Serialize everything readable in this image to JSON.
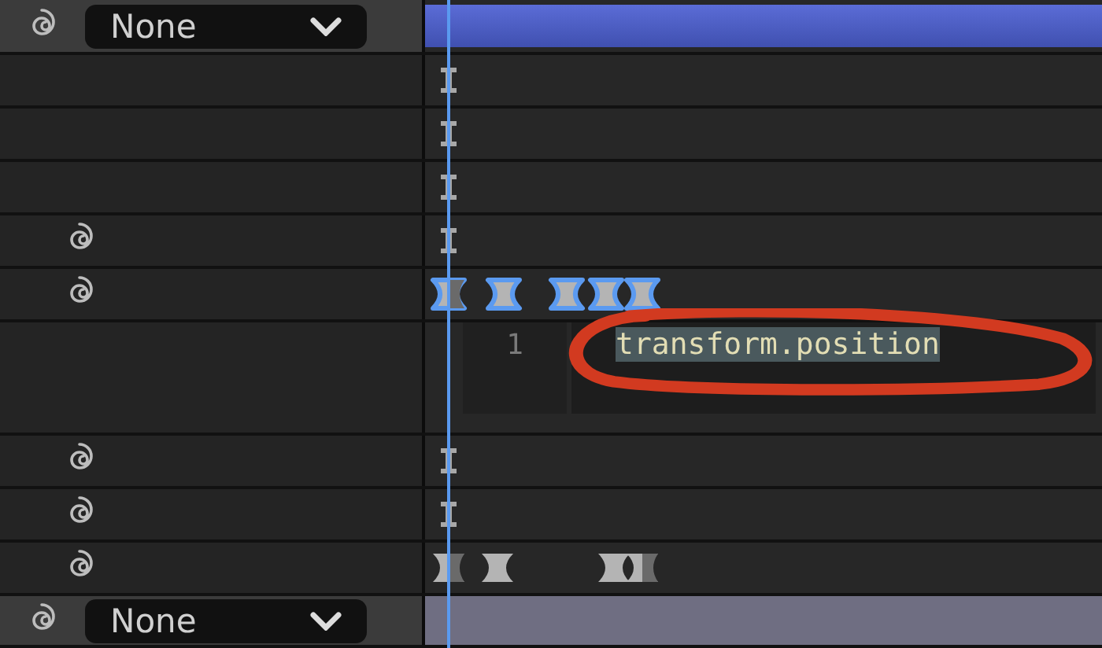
{
  "top_bar": {
    "dropdown": "None"
  },
  "rows": [
    {
      "kind": "property",
      "spiral": false,
      "keyframes": [
        {
          "kind": "marker",
          "selected": false
        }
      ]
    },
    {
      "kind": "property",
      "spiral": false,
      "keyframes": [
        {
          "kind": "marker",
          "selected": false
        }
      ]
    },
    {
      "kind": "property",
      "spiral": false,
      "keyframes": [
        {
          "kind": "marker",
          "selected": false
        }
      ]
    },
    {
      "kind": "property",
      "spiral": true,
      "keyframes": [
        {
          "kind": "marker",
          "selected": false
        }
      ]
    },
    {
      "kind": "property",
      "spiral": true,
      "keyframes": [
        {
          "kind": "ease-half",
          "selected": true
        },
        {
          "kind": "ease",
          "selected": true
        },
        {
          "kind": "ease",
          "selected": true
        },
        {
          "kind": "ease",
          "selected": true
        },
        {
          "kind": "ease",
          "selected": true
        }
      ]
    },
    {
      "kind": "expression",
      "line_number": "1",
      "code": "transform.position",
      "selected": true
    },
    {
      "kind": "property",
      "spiral": true,
      "keyframes": [
        {
          "kind": "marker",
          "selected": false
        }
      ]
    },
    {
      "kind": "property",
      "spiral": true,
      "keyframes": [
        {
          "kind": "marker",
          "selected": false
        }
      ]
    },
    {
      "kind": "property",
      "spiral": true,
      "keyframes": [
        {
          "kind": "ease-half",
          "selected": false
        },
        {
          "kind": "ease",
          "selected": false
        },
        {
          "kind": "ease",
          "selected": false
        },
        {
          "kind": "ease-half",
          "selected": false
        }
      ]
    }
  ],
  "bottom_bar": {
    "dropdown": "None"
  }
}
